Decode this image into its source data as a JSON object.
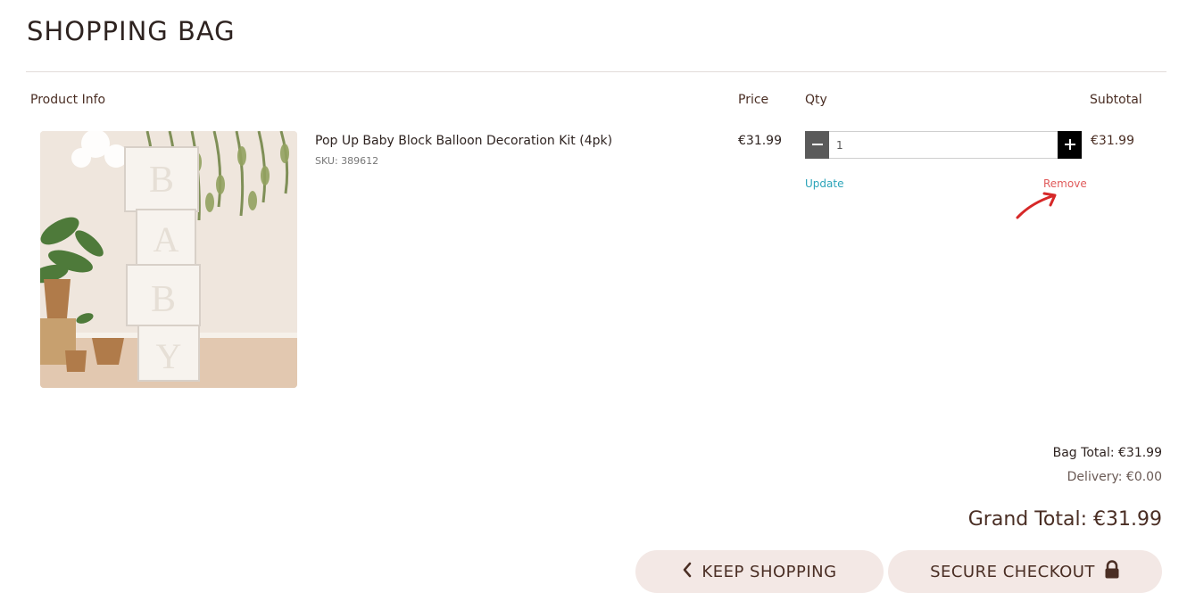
{
  "page": {
    "title": "SHOPPING BAG"
  },
  "table": {
    "headers": {
      "product_info": "Product Info",
      "price": "Price",
      "qty": "Qty",
      "subtotal": "Subtotal"
    }
  },
  "item": {
    "name": "Pop Up Baby Block Balloon Decoration Kit (4pk)",
    "sku": "SKU: 389612",
    "price": "€31.99",
    "qty": "1",
    "subtotal": "€31.99",
    "update_label": "Update",
    "remove_label": "Remove",
    "image_block_letters": [
      "B",
      "A",
      "B",
      "Y"
    ]
  },
  "totals": {
    "bag_total": "Bag Total: €31.99",
    "delivery": "Delivery: €0.00",
    "grand_total": "Grand Total: €31.99"
  },
  "actions": {
    "keep_shopping": "KEEP SHOPPING",
    "secure_checkout": "SECURE CHECKOUT"
  },
  "icons": {
    "minus": "minus-icon",
    "plus": "plus-icon",
    "chevron": "chevron-left-icon",
    "lock": "lock-icon",
    "annotation": "red-arrow-annotation"
  },
  "colors": {
    "accent_teal": "#2aa3b8",
    "remove_red": "#e05a5a",
    "button_bg": "#f3e8e5",
    "text_brown": "#4a2e24"
  }
}
